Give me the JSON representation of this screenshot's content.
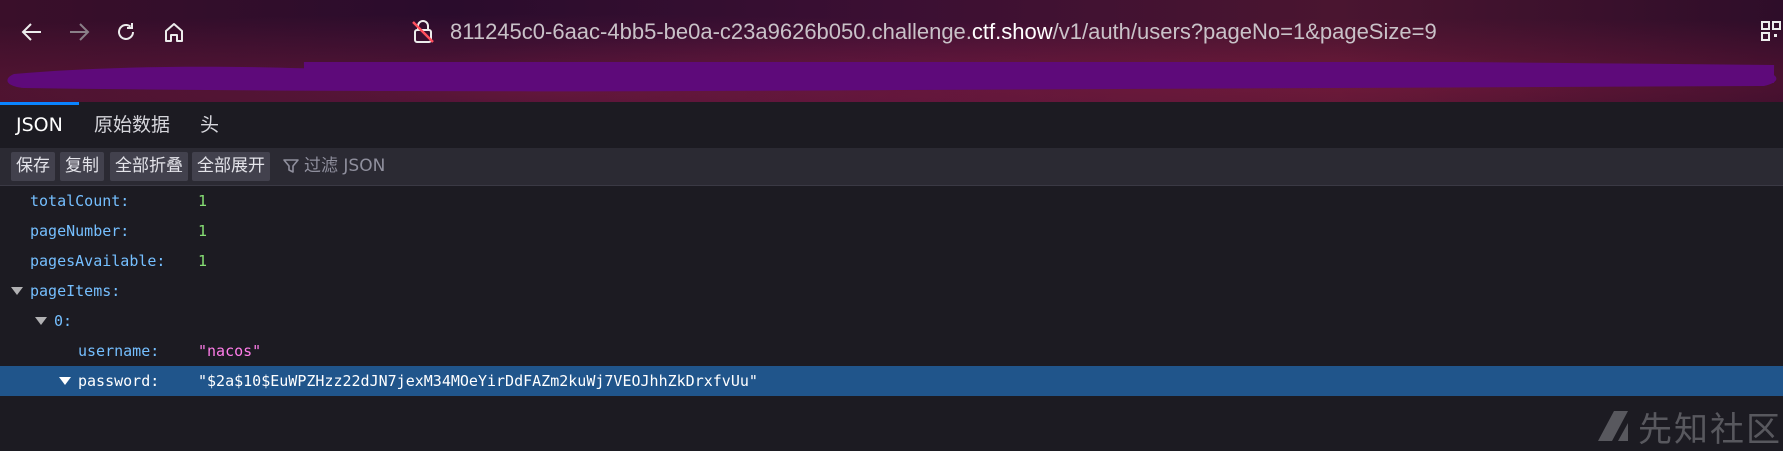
{
  "browser": {
    "url_prefix": "811245c0-6aac-4bb5-be0a-c23a9626b050.challenge.",
    "url_host": "ctf.show",
    "url_path": "/v1/auth/users?pageNo=1&pageSize=9",
    "icons": [
      "back-icon",
      "forward-icon",
      "reload-icon",
      "home-icon",
      "lock-insecure-icon",
      "qr-icon"
    ],
    "redaction_color": "#5e0a7a"
  },
  "viewer": {
    "tabs": [
      {
        "label": "JSON",
        "active": true
      },
      {
        "label": "原始数据",
        "active": false
      },
      {
        "label": "头",
        "active": false
      }
    ],
    "toolbar": {
      "save": "保存",
      "copy": "复制",
      "collapse_all": "全部折叠",
      "expand_all": "全部展开",
      "filter_placeholder": "过滤 JSON"
    }
  },
  "json": {
    "totalCount_key": "totalCount:",
    "totalCount": "1",
    "pageNumber_key": "pageNumber:",
    "pageNumber": "1",
    "pagesAvailable_key": "pagesAvailable:",
    "pagesAvailable": "1",
    "pageItems_key": "pageItems:",
    "item0_key": "0:",
    "username_key": "username:",
    "username": "\"nacos\"",
    "password_key": "password:",
    "password": "\"$2a$10$EuWPZHzz22dJN7jexM34MOeYirDdFAZm2kuWj7VEOJhhZkDrxfvUu\""
  },
  "watermark": {
    "text": "先知社区"
  },
  "colors": {
    "key": "#75bfff",
    "number": "#86de74",
    "string": "#ff7de9",
    "selected_row": "#20558b",
    "active_tab": "#0a84ff"
  }
}
